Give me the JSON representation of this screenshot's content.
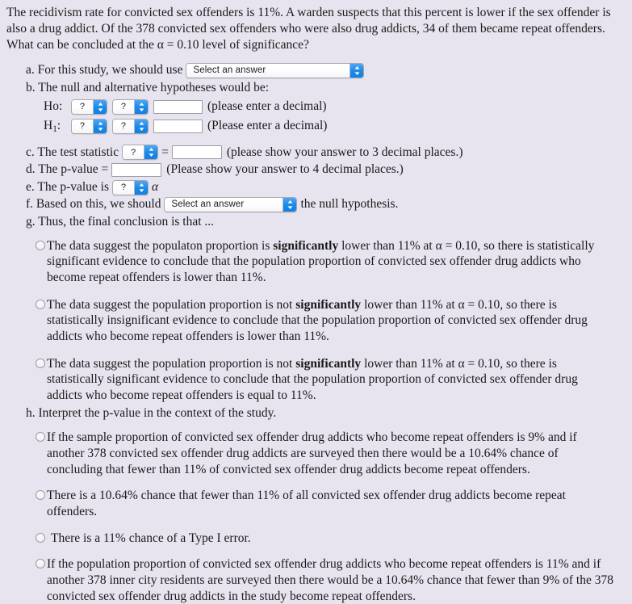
{
  "problem": {
    "text": "The recidivism rate for convicted sex offenders is 11%.  A warden suspects that this percent is lower if the sex offender is also a drug addict. Of the 378 convicted sex offenders who were also drug addicts, 34 of them became repeat offenders. What can be concluded at the α = 0.10 level of significance?"
  },
  "parts": {
    "a": {
      "label": "a. For this study, we should use",
      "select_value": "Select an answer"
    },
    "b": {
      "label": "b. The null and alternative hypotheses would be:",
      "h0": {
        "name": "Ho:",
        "select1": "?",
        "select2": "?",
        "input_value": "",
        "hint": "(please enter a decimal)"
      },
      "h1": {
        "name_prefix": "H",
        "name_sub": "1",
        "name_suffix": ":",
        "select1": "?",
        "select2": "?",
        "input_value": "",
        "hint": "(Please enter a decimal)"
      }
    },
    "c": {
      "label": "c. The test statistic",
      "select_value": "?",
      "equals": "=",
      "input_value": "",
      "hint": "(please show your answer to 3 decimal places.)"
    },
    "d": {
      "label": "d. The p-value =",
      "input_value": "",
      "hint": "(Please show your answer to 4 decimal places.)"
    },
    "e": {
      "label": "e. The p-value is",
      "select_value": "?",
      "alpha": "α"
    },
    "f": {
      "label": "f. Based on this, we should",
      "select_value": "Select an answer",
      "tail": "the null hypothesis."
    },
    "g": {
      "label": "g. Thus, the final conclusion is that ...",
      "options": [
        {
          "lead": "The data suggest the populaton proportion is ",
          "bold": "significantly",
          "rest": " lower than 11% at α = 0.10, so there is statistically significant evidence to conclude that the population proportion of convicted sex offender drug addicts who become repeat offenders is lower than 11%.",
          "selected": false
        },
        {
          "lead": "The data suggest the population proportion is not ",
          "bold": "significantly",
          "rest": " lower than 11% at α = 0.10, so there is statistically insignificant evidence to conclude that the population proportion of convicted sex offender drug addicts who become repeat offenders is lower than 11%.",
          "selected": false
        },
        {
          "lead": "The data suggest the population proportion is not ",
          "bold": "significantly",
          "rest": " lower than 11% at α = 0.10, so there is statistically significant evidence to conclude that the population proportion of convicted sex offender drug addicts who become repeat offenders is equal to 11%.",
          "selected": false
        }
      ]
    },
    "h": {
      "label": "h. Interpret the p-value in the context of the study.",
      "options": [
        {
          "text": "If the sample proportion of convicted sex offender drug addicts who become repeat offenders is 9% and if another 378 convicted sex offender drug addicts are surveyed then there would be a 10.64% chance of concluding that fewer than 11% of convicted sex offender drug addicts become repeat offenders.",
          "selected": false
        },
        {
          "text": "There is a 10.64% chance that fewer than 11% of all convicted sex offender drug addicts become repeat offenders.",
          "selected": false
        },
        {
          "text": "There is a 11% chance of a Type I error.",
          "selected": false
        },
        {
          "text": "If the population proportion of convicted sex offender drug addicts who become repeat offenders is 11% and if another 378 inner city residents are surveyed then there would be a 10.64% chance that fewer than 9% of the 378 convicted sex offender drug addicts in the study become repeat offenders.",
          "selected": false
        }
      ]
    }
  },
  "colors": {
    "page_background": "#e7e4ef",
    "select_arrow_blue": "#1e8ae8",
    "text": "#1a1a1a",
    "input_background": "#ffffff"
  }
}
